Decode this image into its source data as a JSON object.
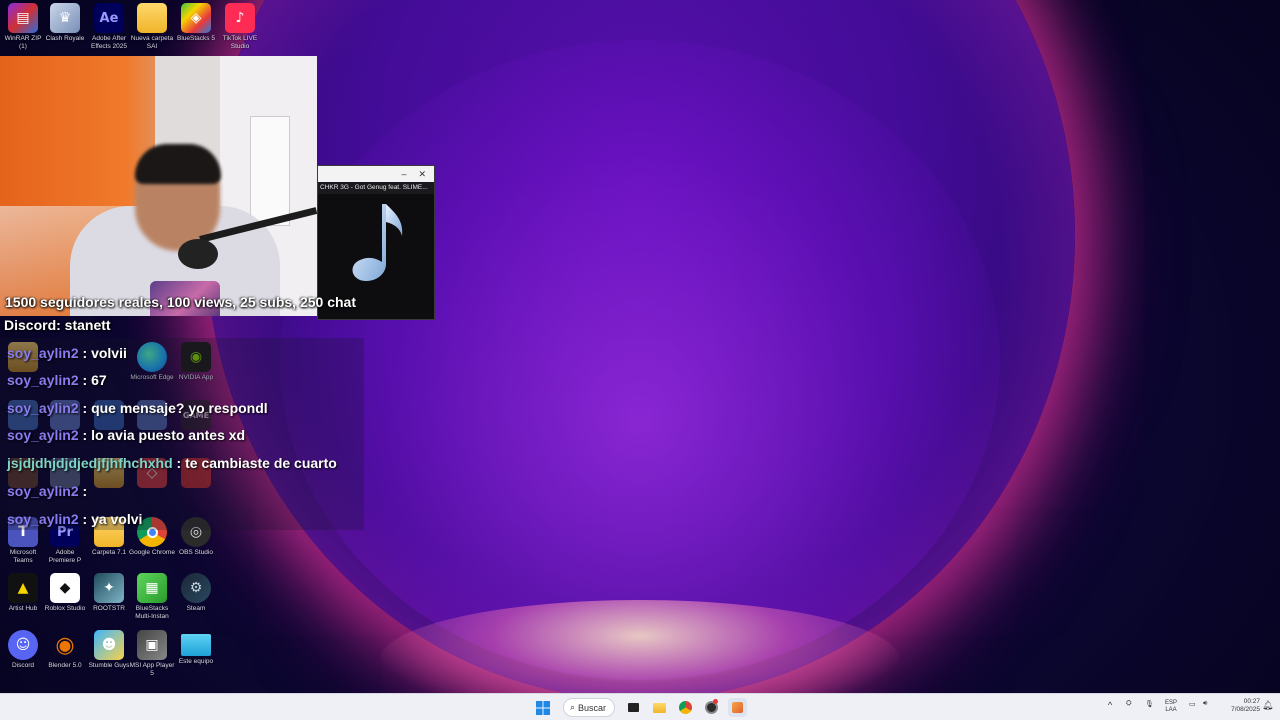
{
  "desktop": {
    "top_icons": [
      {
        "label": "WinRAR ZIP (1)",
        "icon": "winrar-icon"
      },
      {
        "label": "Clash Royale",
        "icon": "clash-royale-icon"
      },
      {
        "label": "Adobe After Effects 2025",
        "icon": "after-effects-icon"
      },
      {
        "label": "Nueva carpeta SAI",
        "icon": "folder-icon"
      },
      {
        "label": "BlueStacks 5",
        "icon": "bluestacks-icon"
      },
      {
        "label": "TikTok LIVE Studio",
        "icon": "tiktok-icon"
      }
    ],
    "hidden_row_icons": [
      {
        "label": "Microsoft Edge",
        "icon": "edge-icon"
      },
      {
        "label": "NVIDIA App",
        "icon": "nvidia-icon"
      }
    ],
    "bottom_icons": [
      {
        "label": "Microsoft Teams",
        "icon": "teams-icon"
      },
      {
        "label": "Adobe Premiere P",
        "icon": "premiere-icon"
      },
      {
        "label": "Carpeta 7.1",
        "icon": "folder-icon"
      },
      {
        "label": "Google Chrome",
        "icon": "chrome-icon"
      },
      {
        "label": "OBS Studio",
        "icon": "obs-icon"
      },
      {
        "label": "Artist Hub",
        "icon": "artist-icon"
      },
      {
        "label": "Roblox Studio",
        "icon": "roblox-icon"
      },
      {
        "label": "ROOTSTR",
        "icon": "game-icon"
      },
      {
        "label": "BlueStacks Multi-Instan",
        "icon": "bluestacks-multi-icon"
      },
      {
        "label": "Steam",
        "icon": "steam-icon"
      },
      {
        "label": "Discord",
        "icon": "discord-icon"
      },
      {
        "label": "Blender 5.0",
        "icon": "blender-icon"
      },
      {
        "label": "Stumble Guys",
        "icon": "stumble-guys-icon"
      },
      {
        "label": "MSI App Player 5",
        "icon": "msi-icon"
      },
      {
        "label": "Este equipo",
        "icon": "monitor-icon"
      }
    ]
  },
  "media_popup": {
    "track_title": "CHKR 3G - Got Genug feat. SLIME...",
    "minimize_glyph": "–",
    "close_glyph": "✕"
  },
  "overlay": {
    "goal": "1500 seguidores reales, 100 views, 25 subs, 250 chat",
    "discord": "Discord: stanett"
  },
  "chat": [
    {
      "user": "soy_aylin2",
      "sep": " : ",
      "message": "volvii",
      "alt": false
    },
    {
      "user": "soy_aylin2",
      "sep": " : ",
      "message": "67",
      "alt": false
    },
    {
      "user": "soy_aylin2",
      "sep": " : ",
      "message": "que mensaje? yo respondl",
      "alt": false
    },
    {
      "user": "soy_aylin2",
      "sep": " : ",
      "message": "lo avia puesto antes xd",
      "alt": false
    },
    {
      "user": "jsjdjdhjdjdjedjfjhfhchxhd",
      "sep": " : ",
      "message": "te cambiaste de cuarto",
      "alt": true
    },
    {
      "user": "soy_aylin2",
      "sep": " : ",
      "message": "",
      "alt": false
    },
    {
      "user": "soy_aylin2",
      "sep": " : ",
      "message": "ya volvi",
      "alt": false
    }
  ],
  "taskbar": {
    "search_label": "Buscar",
    "apps": [
      "start-icon",
      "file-explorer-icon",
      "folder-icon",
      "chrome-icon",
      "obs-icon",
      "media-player-icon"
    ],
    "tray": {
      "lang": "ESP",
      "lang2": "LAA",
      "time": "00:27",
      "date": "7/08/2025"
    }
  },
  "colors": {
    "chat_user": "#8a7cf0",
    "chat_user_alt": "#7fd3c9",
    "wallpaper_accent": "#ff3fa8",
    "taskbar_bg": "#eef0f6"
  }
}
